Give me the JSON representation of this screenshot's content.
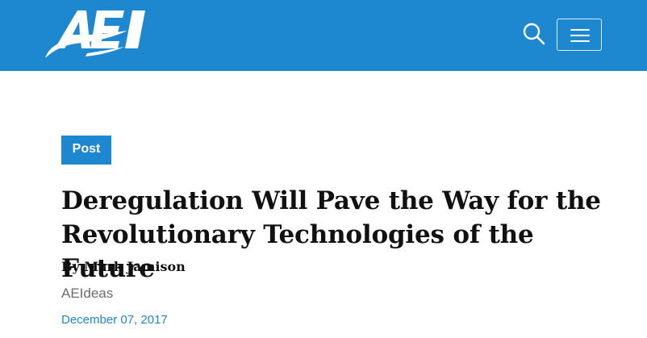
{
  "header": {
    "background_color": "#1d87cf",
    "logo_text": "AEI",
    "search_icon": "search-icon",
    "menu_icon": "hamburger-menu-icon"
  },
  "article": {
    "badge": "Post",
    "badge_color": "#1d87cf",
    "title": "Deregulation Will Pave the Way for the Revolutionary Technologies of the Future",
    "byline": "By Mark Jamison",
    "source": "AEIdeas",
    "date": "December 07, 2017",
    "date_color": "#1d87cf"
  }
}
